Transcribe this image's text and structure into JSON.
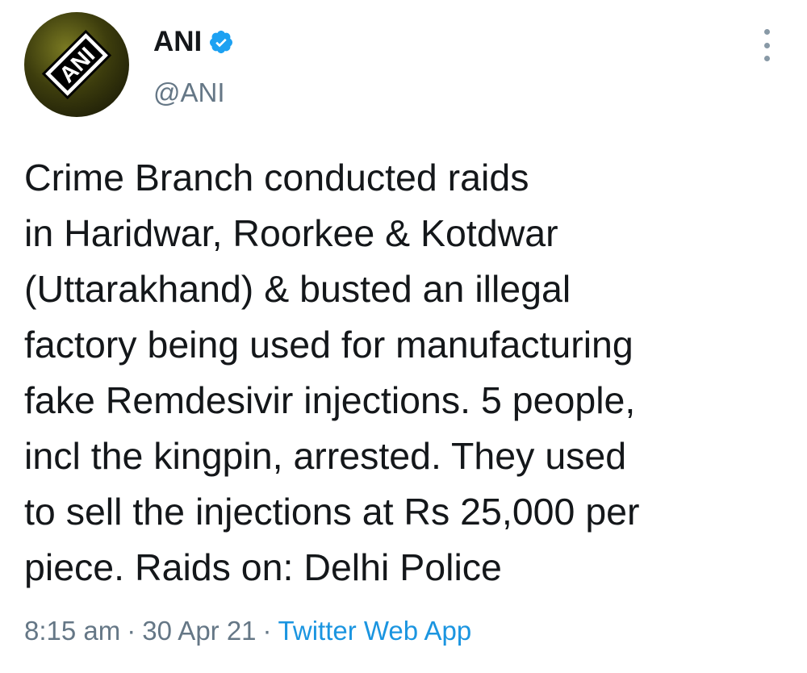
{
  "author": {
    "display_name": "ANI",
    "handle": "@ANI",
    "verified": true,
    "avatar_logo_text": "ANI"
  },
  "tweet": {
    "text_lines": [
      "Crime Branch conducted raids",
      "in Haridwar, Roorkee & Kotdwar",
      "(Uttarakhand) & busted an illegal",
      "factory being used for manufacturing",
      "fake Remdesivir injections. 5 people,",
      "incl the kingpin, arrested. They used",
      "to sell the injections at Rs 25,000 per",
      "piece. Raids on: Delhi Police"
    ],
    "time": "8:15 am",
    "separator": "·",
    "date": "30 Apr 21",
    "source": "Twitter Web App"
  },
  "icons": {
    "verified": "verified-badge-icon",
    "more": "more-options-icon"
  },
  "colors": {
    "text": "#14171a",
    "secondary": "#657786",
    "link": "#1b95e0",
    "verified": "#1da1f2"
  }
}
